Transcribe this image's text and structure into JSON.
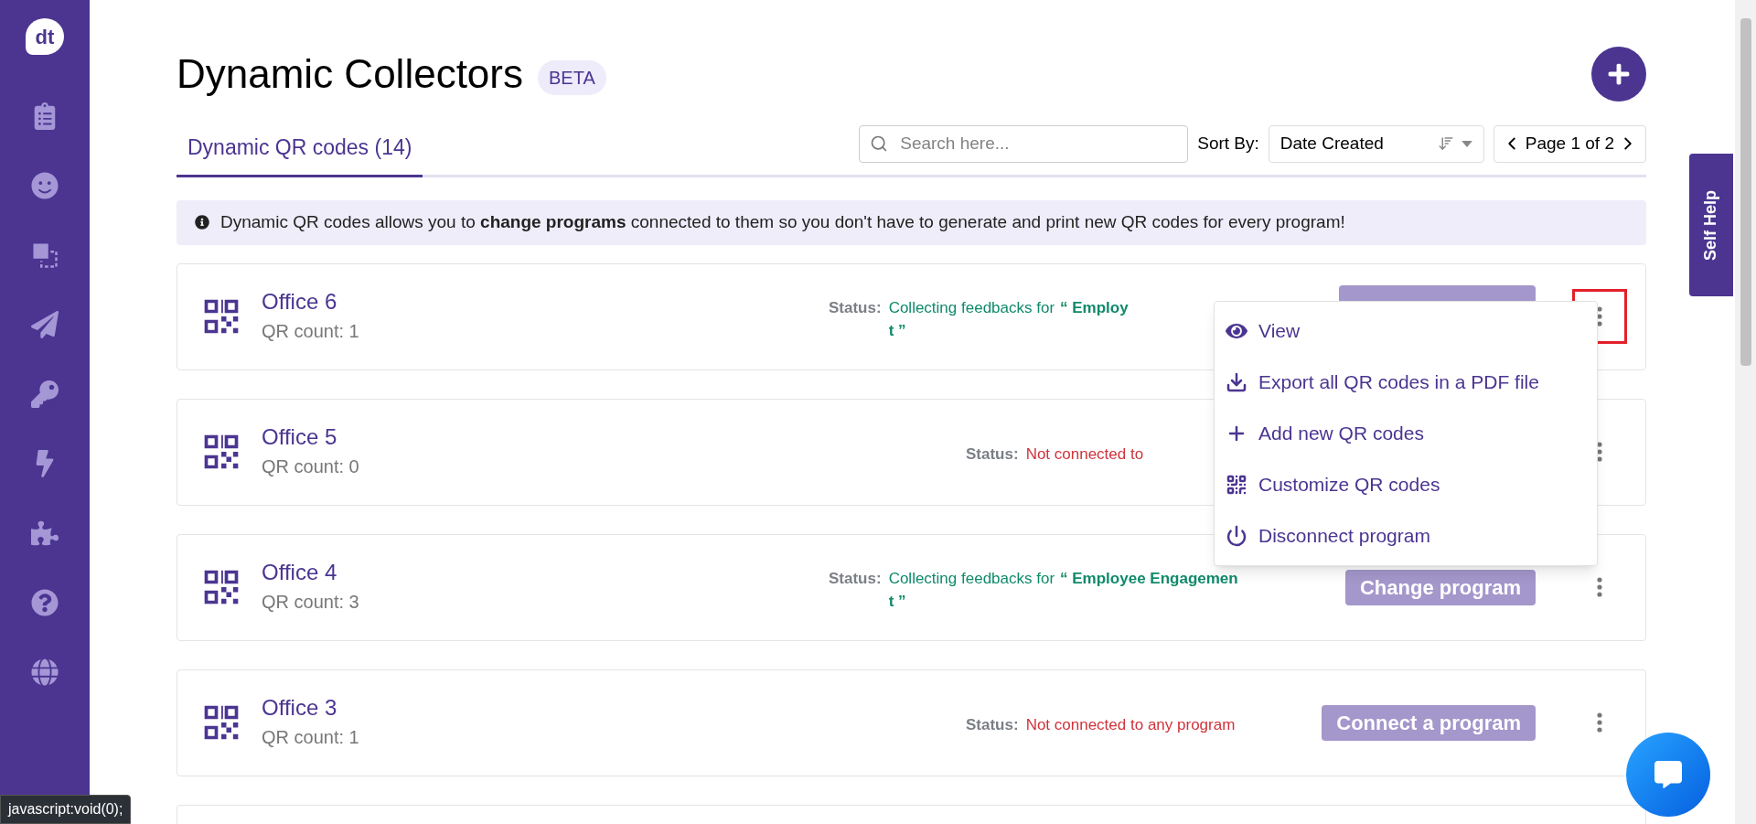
{
  "sidebar": {
    "logo": "dt",
    "items": [
      {
        "kind": "clipboard"
      },
      {
        "kind": "face"
      },
      {
        "kind": "squares"
      },
      {
        "kind": "plane"
      },
      {
        "kind": "key"
      },
      {
        "kind": "bolt"
      },
      {
        "kind": "puzzle"
      },
      {
        "kind": "help"
      },
      {
        "kind": "globe"
      }
    ]
  },
  "header": {
    "title": "Dynamic Collectors",
    "badge": "BETA"
  },
  "tabs": [
    {
      "label": "Dynamic QR codes (14)",
      "selected": true
    }
  ],
  "search": {
    "placeholder": "Search here..."
  },
  "sort": {
    "label": "Sort By:",
    "value": "Date Created"
  },
  "pager": {
    "label": "Page 1 of 2"
  },
  "info": "Dynamic QR codes allows you to **change programs** connected to them so you don't have to generate and print new QR codes for every program!",
  "collectors": [
    {
      "name": "Office 6",
      "count": "QR count: 1",
      "status_label": "Status:",
      "connected": true,
      "status_text": "Collecting feedbacks for",
      "program_lines": [
        "“ Employ",
        "t ”"
      ],
      "menu_open": true
    },
    {
      "name": "Office 5",
      "count": "QR count: 0",
      "status_label": "Status:",
      "connected": false,
      "status_text": "Not connected to",
      "menu_open": false
    },
    {
      "name": "Office 4",
      "count": "QR count: 3",
      "status_label": "Status:",
      "connected": true,
      "status_text": "Collecting feedbacks for",
      "program_lines": [
        "“ Employee Engagemen",
        "t ”"
      ],
      "button": "Change program",
      "menu_open": false
    },
    {
      "name": "Office 3",
      "count": "QR count: 1",
      "status_label": "Status:",
      "connected": false,
      "status_text": "Not connected to any program",
      "button": "Connect a program",
      "menu_open": false
    }
  ],
  "menu": [
    {
      "kind": "view",
      "label": "View"
    },
    {
      "kind": "export",
      "label": "Export all QR codes in a PDF file"
    },
    {
      "kind": "add",
      "label": "Add new QR codes"
    },
    {
      "kind": "customize",
      "label": "Customize QR codes"
    },
    {
      "kind": "disconnect",
      "label": "Disconnect program"
    }
  ],
  "self_help": "Self Help",
  "status_bar": "javascript:void(0);"
}
